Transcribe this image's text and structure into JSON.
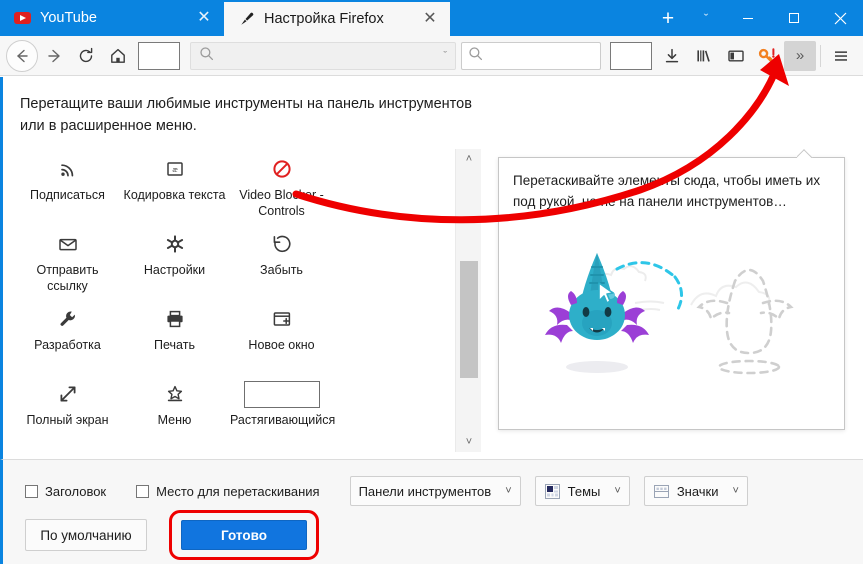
{
  "window": {
    "minimize_label": "Свернуть",
    "maximize_label": "Развернуть",
    "close_label": "Закрыть"
  },
  "tabs": {
    "items": [
      {
        "title": "YouTube",
        "favicon": "youtube-icon",
        "active": false,
        "close_label": "✕"
      },
      {
        "title": "Настройка Firefox",
        "favicon": "paintbrush-icon",
        "active": true,
        "close_label": "✕"
      }
    ],
    "new_tab_label": "+",
    "list_all_tabs_label": "ˇ"
  },
  "navbar": {
    "back_label": "back-icon",
    "forward_label": "forward-icon",
    "reload_label": "reload-icon",
    "home_label": "home-icon",
    "urlbar_placeholder": "",
    "urlbar_value": "",
    "urlbar_chevron": "ˇ",
    "search_placeholder": "",
    "search_value": "",
    "downloads_label": "downloads-icon",
    "library_label": "library-icon",
    "sidebar_label": "sidebar-icon",
    "lockwise_label": "key-warning-icon",
    "overflow_label": "»",
    "menu_label": "hamburger-icon"
  },
  "customize": {
    "hint": "Перетащите ваши любимые инструменты на панель инструментов или в расширенное меню.",
    "palette": [
      {
        "label": "Подписаться",
        "icon": "rss-icon"
      },
      {
        "label": "Кодировка текста",
        "icon": "text-encoding-icon"
      },
      {
        "label": "Video Blocker - Controls",
        "icon": "block-icon"
      },
      {
        "label": "Отправить ссылку",
        "icon": "email-icon"
      },
      {
        "label": "Настройки",
        "icon": "settings-icon"
      },
      {
        "label": "Забыть",
        "icon": "forget-history-icon"
      },
      {
        "label": "Разработка",
        "icon": "wrench-icon"
      },
      {
        "label": "Печать",
        "icon": "printer-icon"
      },
      {
        "label": "Новое окно",
        "icon": "new-window-icon"
      },
      {
        "label": "Полный экран",
        "icon": "fullscreen-icon"
      },
      {
        "label": "Меню",
        "icon": "bookmark-menu-icon"
      },
      {
        "label": "Растягивающийся",
        "icon": "flexible-space-icon"
      }
    ],
    "scroll_up": "˄",
    "scroll_down": "˅"
  },
  "overflow_panel": {
    "text": "Перетаскивайте элементы сюда, чтобы иметь их под рукой, но не на панели инструментов…"
  },
  "bottom": {
    "checkboxes": [
      {
        "label": "Заголовок",
        "checked": false
      },
      {
        "label": "Место для перетаскивания",
        "checked": false
      }
    ],
    "dropdowns": [
      {
        "label": "Панели инструментов",
        "icon": null,
        "chevron": "˅"
      },
      {
        "label": "Темы",
        "icon": "themes-icon",
        "chevron": "˅"
      },
      {
        "label": "Значки",
        "icon": "density-icon",
        "chevron": "˅"
      }
    ],
    "restore_defaults_label": "По умолчанию",
    "done_label": "Готово"
  },
  "colors": {
    "tabbar_blue": "#0a84e0",
    "accent_blue": "#1175df",
    "annotation_red": "#ee0000",
    "block_icon_red": "#e02020",
    "key_orange": "#f28021",
    "monster_teal": "#2eafc9",
    "monster_purple": "#9b3fd6"
  }
}
